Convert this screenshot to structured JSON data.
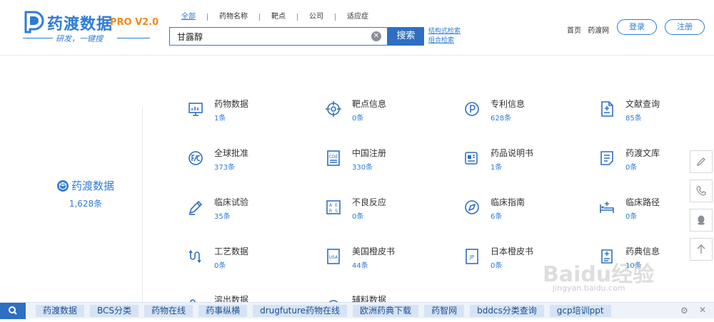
{
  "logo": {
    "title": "药渡数据",
    "version": "PRO V2.0",
    "slogan": "研发，一键搜"
  },
  "search": {
    "tabs": [
      {
        "label": "全部",
        "active": true
      },
      {
        "label": "药物名称",
        "active": false
      },
      {
        "label": "靶点",
        "active": false
      },
      {
        "label": "公司",
        "active": false
      },
      {
        "label": "适应症",
        "active": false
      }
    ],
    "value": "甘露醇",
    "button": "搜索",
    "adv_structure": "结构式检索",
    "adv_combo": "组合检索"
  },
  "topnav": {
    "home": "首页",
    "site": "药渡网",
    "login": "登录",
    "register": "注册"
  },
  "left": {
    "title": "药渡数据",
    "count": "1,628条"
  },
  "categories": [
    {
      "name": "药物数据",
      "count": "1条",
      "icon": "monitor-chart-icon"
    },
    {
      "name": "靶点信息",
      "count": "0条",
      "icon": "target-icon"
    },
    {
      "name": "专利信息",
      "count": "628条",
      "icon": "patent-icon"
    },
    {
      "name": "文献查询",
      "count": "85条",
      "icon": "document-icon"
    },
    {
      "name": "全球批准",
      "count": "373条",
      "icon": "fc-approval-icon"
    },
    {
      "name": "中国注册",
      "count": "330条",
      "icon": "cde-icon"
    },
    {
      "name": "药品说明书",
      "count": "1条",
      "icon": "manual-icon"
    },
    {
      "name": "药渡文库",
      "count": "0条",
      "icon": "library-icon"
    },
    {
      "name": "临床试验",
      "count": "35条",
      "icon": "pen-icon"
    },
    {
      "name": "不良反应",
      "count": "0条",
      "icon": "aers-icon"
    },
    {
      "name": "临床指南",
      "count": "6条",
      "icon": "compass-icon"
    },
    {
      "name": "临床路径",
      "count": "0条",
      "icon": "bed-icon"
    },
    {
      "name": "工艺数据",
      "count": "0条",
      "icon": "flow-icon"
    },
    {
      "name": "美国橙皮书",
      "count": "44条",
      "icon": "usa-book-icon"
    },
    {
      "name": "日本橙皮书",
      "count": "0条",
      "icon": "jp-book-icon"
    },
    {
      "name": "药典信息",
      "count": "10条",
      "icon": "pharmacopoeia-icon"
    },
    {
      "name": "溶出数据",
      "count": "",
      "icon": "dissolution-icon"
    },
    {
      "name": "辅料数据",
      "count": "",
      "icon": "excipient-icon"
    }
  ],
  "bottombar": {
    "items": [
      "药渡数据",
      "BCS分类",
      "药物在线",
      "药事纵横",
      "drugfuture药物在线",
      "欧洲药典下载",
      "药智网",
      "bddcs分类查询",
      "gcp培训ppt"
    ]
  },
  "watermark": {
    "text": "Baidu经验",
    "url": "jingyan.baidu.com"
  },
  "colors": {
    "accent": "#2e7bd6",
    "button": "#2e6fc2",
    "orange": "#f08a1c"
  }
}
